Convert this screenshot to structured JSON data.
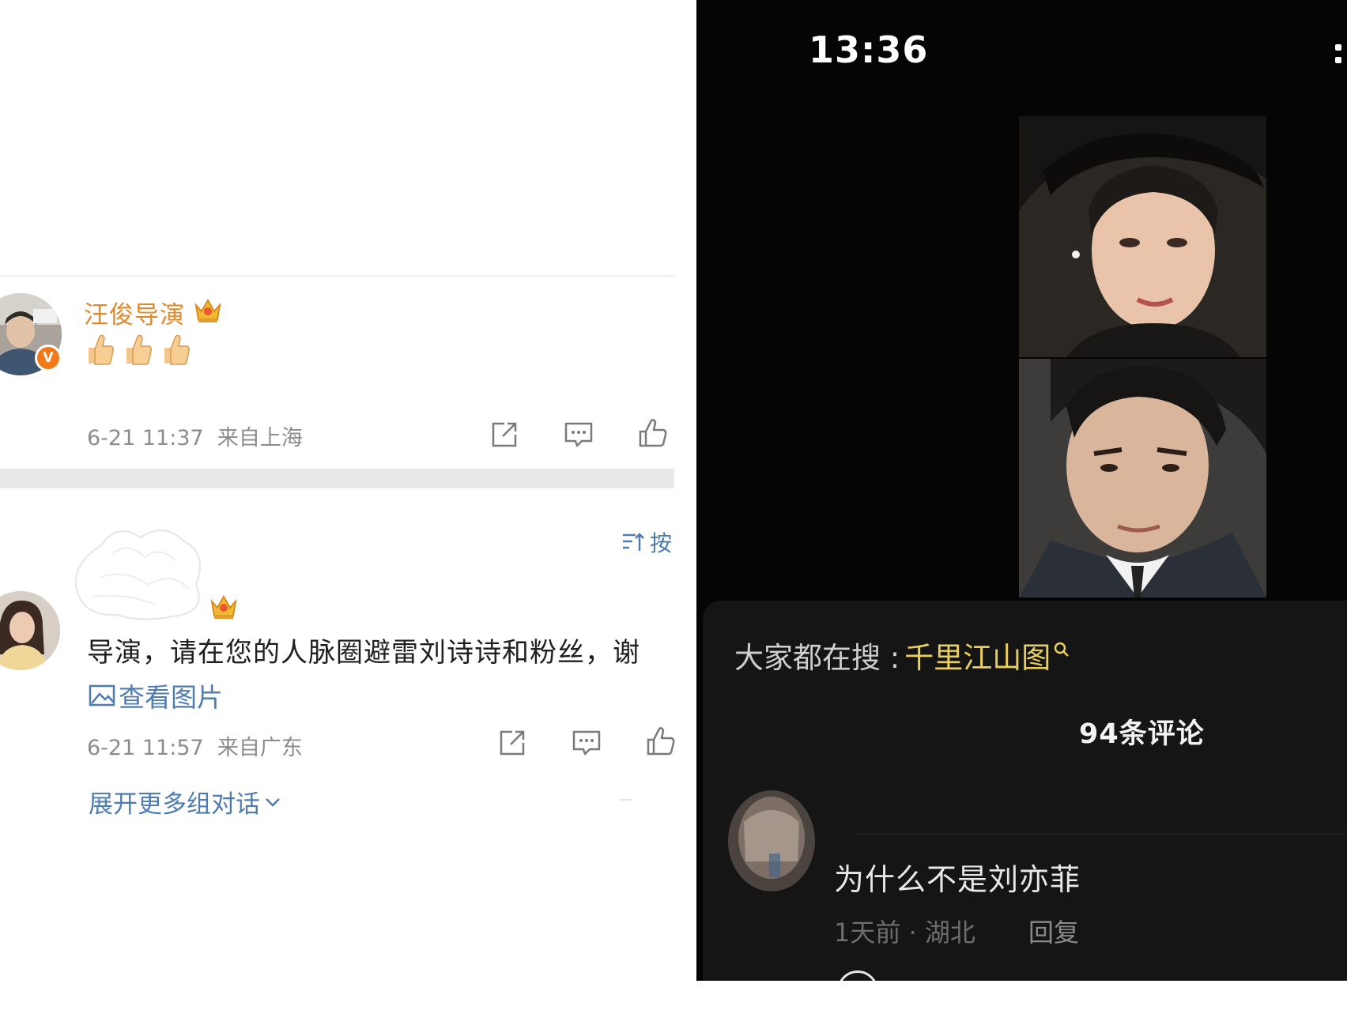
{
  "left": {
    "post": {
      "username": "汪俊导演",
      "emoji": [
        "thumbs-up",
        "thumbs-up",
        "thumbs-up"
      ],
      "timestamp": "6-21 11:37",
      "location": "来自上海"
    },
    "sort": {
      "label": "按"
    },
    "comment": {
      "text": "导演，请在您的人脉圈避雷刘诗诗和粉丝，谢",
      "view_image": "查看图片",
      "timestamp": "6-21 11:57",
      "location": "来自广东"
    },
    "expand_label": "展开更多组对话"
  },
  "right": {
    "clock": "13:36",
    "trending": {
      "prefix": "大家都在搜 : ",
      "term": "千里江山图"
    },
    "comment_count": "94条评论",
    "comment": {
      "text": "为什么不是刘亦菲",
      "meta": "1天前 · 湖北",
      "reply": "回复"
    }
  },
  "colors": {
    "weibo_link": "#4e7cb2",
    "weibo_username": "#e08a2e",
    "trend_term": "#ead05c",
    "dark_bg": "#050505",
    "sheet_bg": "#151515"
  },
  "icons": [
    "v-verified-icon",
    "crown-icon",
    "thumbs-up-icon",
    "share-icon",
    "comment-icon",
    "like-icon",
    "image-icon",
    "chevron-down-icon",
    "sort-icon",
    "search-icon",
    "more-icon"
  ]
}
